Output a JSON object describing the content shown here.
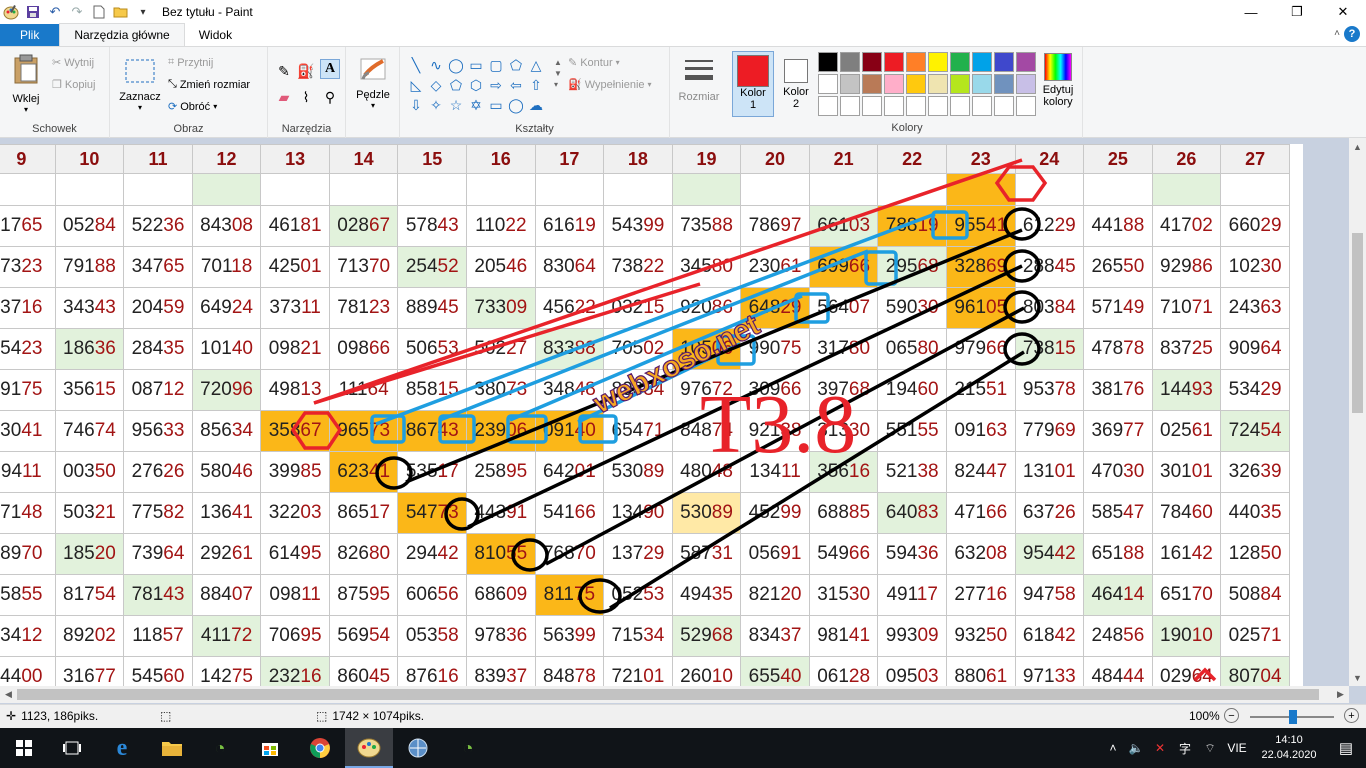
{
  "window": {
    "title": "Bez tytułu - Paint",
    "controls": {
      "minimize": "—",
      "maximize": "❐",
      "close": "✕"
    }
  },
  "tabs": [
    {
      "label": "Plik"
    },
    {
      "label": "Narzędzia główne"
    },
    {
      "label": "Widok"
    }
  ],
  "ribbon": {
    "clipboard": {
      "label": "Schowek",
      "paste": "Wklej",
      "cut": "Wytnij",
      "copy": "Kopiuj"
    },
    "image": {
      "label": "Obraz",
      "select": "Zaznacz",
      "crop": "Przytnij",
      "resize": "Zmień rozmiar",
      "rotate": "Obróć"
    },
    "tools": {
      "label": "Narzędzia"
    },
    "brushes": {
      "label": "Pędzle"
    },
    "shapes": {
      "label": "Kształty",
      "outline": "Kontur",
      "fill": "Wypełnienie"
    },
    "size": {
      "label": "Rozmiar"
    },
    "color1": {
      "label": "Kolor",
      "num": "1",
      "value": "#ed1c24"
    },
    "color2": {
      "label": "Kolor",
      "num": "2",
      "value": "#ffffff"
    },
    "colors": {
      "label": "Kolory",
      "edit": "Edytuj",
      "edit2": "kolory"
    },
    "palette": [
      "#000000",
      "#7f7f7f",
      "#880015",
      "#ed1c24",
      "#ff7f27",
      "#fff200",
      "#22b14c",
      "#00a2e8",
      "#3f48cc",
      "#a349a4",
      "#ffffff",
      "#c3c3c3",
      "#b97a57",
      "#ffaec9",
      "#ffc90e",
      "#efe4b0",
      "#b5e61d",
      "#99d9ea",
      "#7092be",
      "#c8bfe7",
      "#ffffff",
      "#ffffff",
      "#ffffff",
      "#ffffff",
      "#ffffff",
      "#ffffff",
      "#ffffff",
      "#ffffff",
      "#ffffff",
      "#ffffff"
    ]
  },
  "grid": {
    "headers": [
      "9",
      "10",
      "11",
      "12",
      "13",
      "14",
      "15",
      "16",
      "17",
      "18",
      "19",
      "20",
      "21",
      "22",
      "23",
      "24",
      "25",
      "26",
      "27"
    ],
    "rows": [
      [
        [
          "17",
          "65"
        ],
        [
          "052",
          "84"
        ],
        [
          "522",
          "36"
        ],
        [
          "843",
          "08"
        ],
        [
          "461",
          "81"
        ],
        [
          "028",
          "67"
        ],
        [
          "578",
          "43"
        ],
        [
          "110",
          "22"
        ],
        [
          "616",
          "19"
        ],
        [
          "543",
          "99"
        ],
        [
          "735",
          "88"
        ],
        [
          "786",
          "97"
        ],
        [
          "661",
          "03"
        ],
        [
          "788",
          "19"
        ],
        [
          "955",
          "41"
        ],
        [
          "612",
          "29"
        ],
        [
          "441",
          "88"
        ],
        [
          "417",
          "02"
        ],
        [
          "660",
          "29"
        ]
      ],
      [
        [
          "73",
          "23"
        ],
        [
          "791",
          "88"
        ],
        [
          "347",
          "65"
        ],
        [
          "701",
          "18"
        ],
        [
          "425",
          "01"
        ],
        [
          "713",
          "70"
        ],
        [
          "254",
          "52"
        ],
        [
          "205",
          "46"
        ],
        [
          "830",
          "64"
        ],
        [
          "738",
          "22"
        ],
        [
          "345",
          "80"
        ],
        [
          "230",
          "61"
        ],
        [
          "699",
          "66"
        ],
        [
          "295",
          "68"
        ],
        [
          "328",
          "69"
        ],
        [
          "288",
          "45"
        ],
        [
          "265",
          "50"
        ],
        [
          "929",
          "86"
        ],
        [
          "102",
          "30"
        ]
      ],
      [
        [
          "37",
          "16"
        ],
        [
          "343",
          "43"
        ],
        [
          "204",
          "59"
        ],
        [
          "649",
          "24"
        ],
        [
          "373",
          "11"
        ],
        [
          "781",
          "23"
        ],
        [
          "889",
          "45"
        ],
        [
          "733",
          "09"
        ],
        [
          "456",
          "22"
        ],
        [
          "032",
          "15"
        ],
        [
          "920",
          "86"
        ],
        [
          "648",
          "29"
        ],
        [
          "564",
          "07"
        ],
        [
          "590",
          "30"
        ],
        [
          "961",
          "05"
        ],
        [
          "803",
          "84"
        ],
        [
          "571",
          "49"
        ],
        [
          "710",
          "71"
        ],
        [
          "243",
          "63"
        ]
      ],
      [
        [
          "54",
          "23"
        ],
        [
          "186",
          "36"
        ],
        [
          "284",
          "35"
        ],
        [
          "101",
          "40"
        ],
        [
          "098",
          "21"
        ],
        [
          "098",
          "66"
        ],
        [
          "506",
          "53"
        ],
        [
          "502",
          "27"
        ],
        [
          "833",
          "88"
        ],
        [
          "705",
          "02"
        ],
        [
          "105",
          "06"
        ],
        [
          "990",
          "75"
        ],
        [
          "317",
          "80"
        ],
        [
          "065",
          "80"
        ],
        [
          "979",
          "66"
        ],
        [
          "738",
          "15"
        ],
        [
          "478",
          "78"
        ],
        [
          "837",
          "25"
        ],
        [
          "909",
          "64"
        ]
      ],
      [
        [
          "91",
          "75"
        ],
        [
          "356",
          "15"
        ],
        [
          "087",
          "12"
        ],
        [
          "720",
          "96"
        ],
        [
          "498",
          "13"
        ],
        [
          "111",
          "64"
        ],
        [
          "858",
          "15"
        ],
        [
          "380",
          "73"
        ],
        [
          "348",
          "48"
        ],
        [
          "893",
          "34"
        ],
        [
          "976",
          "72"
        ],
        [
          "309",
          "66"
        ],
        [
          "397",
          "68"
        ],
        [
          "194",
          "60"
        ],
        [
          "215",
          "51"
        ],
        [
          "953",
          "78"
        ],
        [
          "381",
          "76"
        ],
        [
          "144",
          "93"
        ],
        [
          "534",
          "29"
        ]
      ],
      [
        [
          "30",
          "41"
        ],
        [
          "746",
          "74"
        ],
        [
          "956",
          "33"
        ],
        [
          "856",
          "34"
        ],
        [
          "358",
          "67"
        ],
        [
          "965",
          "73"
        ],
        [
          "867",
          "43"
        ],
        [
          "239",
          "06"
        ],
        [
          "091",
          "40"
        ],
        [
          "654",
          "71"
        ],
        [
          "848",
          "74"
        ],
        [
          "921",
          "38"
        ],
        [
          "313",
          "30"
        ],
        [
          "551",
          "55"
        ],
        [
          "091",
          "63"
        ],
        [
          "779",
          "69"
        ],
        [
          "369",
          "77"
        ],
        [
          "025",
          "61"
        ],
        [
          "724",
          "54"
        ]
      ],
      [
        [
          "94",
          "11"
        ],
        [
          "003",
          "50"
        ],
        [
          "276",
          "26"
        ],
        [
          "580",
          "46"
        ],
        [
          "399",
          "85"
        ],
        [
          "623",
          "41"
        ],
        [
          "535",
          "17"
        ],
        [
          "258",
          "95"
        ],
        [
          "642",
          "01"
        ],
        [
          "530",
          "89"
        ],
        [
          "480",
          "48"
        ],
        [
          "134",
          "11"
        ],
        [
          "356",
          "16"
        ],
        [
          "521",
          "38"
        ],
        [
          "824",
          "47"
        ],
        [
          "131",
          "01"
        ],
        [
          "470",
          "30"
        ],
        [
          "301",
          "01"
        ],
        [
          "326",
          "39"
        ]
      ],
      [
        [
          "71",
          "48"
        ],
        [
          "503",
          "21"
        ],
        [
          "775",
          "82"
        ],
        [
          "136",
          "41"
        ],
        [
          "322",
          "03"
        ],
        [
          "865",
          "17"
        ],
        [
          "547",
          "73"
        ],
        [
          "443",
          "91"
        ],
        [
          "541",
          "66"
        ],
        [
          "134",
          "90"
        ],
        [
          "530",
          "89"
        ],
        [
          "452",
          "99"
        ],
        [
          "688",
          "85"
        ],
        [
          "640",
          "83"
        ],
        [
          "471",
          "66"
        ],
        [
          "637",
          "26"
        ],
        [
          "585",
          "47"
        ],
        [
          "784",
          "60"
        ],
        [
          "440",
          "35"
        ]
      ],
      [
        [
          "89",
          "70"
        ],
        [
          "185",
          "20"
        ],
        [
          "739",
          "64"
        ],
        [
          "292",
          "61"
        ],
        [
          "614",
          "95"
        ],
        [
          "826",
          "80"
        ],
        [
          "294",
          "42"
        ],
        [
          "810",
          "55"
        ],
        [
          "768",
          "70"
        ],
        [
          "137",
          "29"
        ],
        [
          "587",
          "31"
        ],
        [
          "056",
          "91"
        ],
        [
          "549",
          "66"
        ],
        [
          "594",
          "36"
        ],
        [
          "632",
          "08"
        ],
        [
          "954",
          "42"
        ],
        [
          "651",
          "88"
        ],
        [
          "161",
          "42"
        ],
        [
          "128",
          "50"
        ]
      ],
      [
        [
          "58",
          "55"
        ],
        [
          "817",
          "54"
        ],
        [
          "781",
          "43"
        ],
        [
          "884",
          "07"
        ],
        [
          "098",
          "11"
        ],
        [
          "875",
          "95"
        ],
        [
          "606",
          "56"
        ],
        [
          "686",
          "09"
        ],
        [
          "811",
          "75"
        ],
        [
          "052",
          "53"
        ],
        [
          "494",
          "35"
        ],
        [
          "821",
          "20"
        ],
        [
          "315",
          "30"
        ],
        [
          "491",
          "17"
        ],
        [
          "277",
          "16"
        ],
        [
          "947",
          "58"
        ],
        [
          "464",
          "14"
        ],
        [
          "651",
          "70"
        ],
        [
          "508",
          "84"
        ]
      ],
      [
        [
          "34",
          "12"
        ],
        [
          "892",
          "02"
        ],
        [
          "118",
          "57"
        ],
        [
          "411",
          "72"
        ],
        [
          "706",
          "95"
        ],
        [
          "569",
          "54"
        ],
        [
          "053",
          "58"
        ],
        [
          "978",
          "36"
        ],
        [
          "563",
          "99"
        ],
        [
          "715",
          "34"
        ],
        [
          "529",
          "68"
        ],
        [
          "834",
          "37"
        ],
        [
          "981",
          "41"
        ],
        [
          "993",
          "09"
        ],
        [
          "932",
          "50"
        ],
        [
          "618",
          "42"
        ],
        [
          "248",
          "56"
        ],
        [
          "190",
          "10"
        ],
        [
          "025",
          "71"
        ]
      ],
      [
        [
          "44",
          "00"
        ],
        [
          "316",
          "77"
        ],
        [
          "545",
          "60"
        ],
        [
          "142",
          "75"
        ],
        [
          "232",
          "16"
        ],
        [
          "860",
          "45"
        ],
        [
          "876",
          "16"
        ],
        [
          "839",
          "37"
        ],
        [
          "848",
          "78"
        ],
        [
          "721",
          "01"
        ],
        [
          "260",
          "10"
        ],
        [
          "655",
          "40"
        ],
        [
          "061",
          "28"
        ],
        [
          "095",
          "03"
        ],
        [
          "880",
          "61"
        ],
        [
          "971",
          "33"
        ],
        [
          "484",
          "44"
        ],
        [
          "029",
          "64"
        ],
        [
          "807",
          "04"
        ]
      ]
    ],
    "shade": {
      "blank": [
        "",
        "",
        "",
        "g",
        "",
        "",
        "",
        "",
        "",
        "",
        "g",
        "",
        "",
        "",
        "o",
        "",
        "",
        "g",
        ""
      ],
      "r0": [
        "",
        "",
        "",
        "",
        "",
        "g",
        "",
        "",
        "",
        "",
        "",
        "",
        "g",
        "o",
        "o",
        "",
        "",
        "",
        ""
      ],
      "r1": [
        "",
        "",
        "",
        "",
        "",
        "",
        "g",
        "",
        "",
        "",
        "",
        "",
        "o",
        "g",
        "o",
        "",
        "",
        "",
        ""
      ],
      "r2": [
        "",
        "",
        "",
        "",
        "",
        "",
        "",
        "g",
        "",
        "",
        "",
        "o",
        "",
        "",
        "o",
        "",
        "",
        "",
        ""
      ],
      "r3": [
        "",
        "g",
        "",
        "",
        "",
        "",
        "",
        "",
        "g",
        "",
        "o",
        "",
        "",
        "",
        "",
        "g",
        "",
        "",
        ""
      ],
      "r4": [
        "",
        "",
        "",
        "g",
        "",
        "",
        "",
        "",
        "",
        "",
        "",
        "",
        "",
        "",
        "",
        "",
        "",
        "g",
        ""
      ],
      "r5": [
        "",
        "",
        "",
        "",
        "o",
        "o",
        "o",
        "o",
        "o",
        "",
        "",
        "",
        "",
        "",
        "",
        "",
        "",
        "",
        "g"
      ],
      "r6": [
        "",
        "",
        "",
        "",
        "",
        "o",
        "",
        "",
        "",
        "",
        "",
        "",
        "g",
        "",
        "",
        "",
        "",
        "",
        ""
      ],
      "r7": [
        "",
        "",
        "",
        "",
        "",
        "",
        "o",
        "",
        "",
        "",
        "y",
        "",
        "",
        "g",
        "",
        "",
        "",
        "",
        ""
      ],
      "r8": [
        "",
        "g",
        "",
        "",
        "",
        "",
        "",
        "o",
        "",
        "",
        "",
        "",
        "",
        "",
        "",
        "g",
        "",
        "",
        ""
      ],
      "r9": [
        "",
        "",
        "g",
        "",
        "",
        "",
        "",
        "",
        "o",
        "",
        "",
        "",
        "",
        "",
        "",
        "",
        "g",
        "",
        ""
      ],
      "r10": [
        "",
        "",
        "",
        "g",
        "",
        "",
        "",
        "",
        "",
        "",
        "g",
        "",
        "",
        "",
        "",
        "",
        "",
        "g",
        ""
      ],
      "r11": [
        "",
        "",
        "",
        "",
        "g",
        "",
        "",
        "",
        "",
        "",
        "",
        "g",
        "",
        "",
        "",
        "",
        "",
        "",
        "g"
      ]
    }
  },
  "overlay": {
    "watermark": "webxoso.net",
    "label": "T3.8"
  },
  "status": {
    "cursor": "1123, 186piks.",
    "size": "1742 × 1074piks.",
    "zoom": "100%"
  },
  "taskbar": {
    "lang": "VIE",
    "time": "14:10",
    "date": "22.04.2020"
  }
}
